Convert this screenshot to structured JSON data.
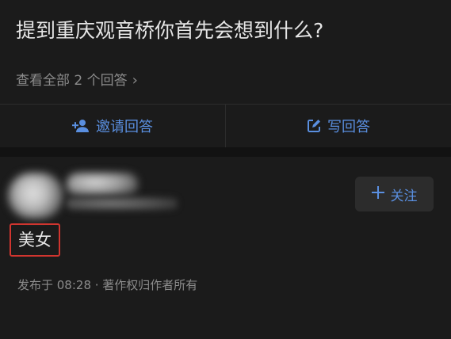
{
  "question": {
    "title": "提到重庆观音桥你首先会想到什么?",
    "view_all": "查看全部 2 个回答"
  },
  "actions": {
    "invite_label": "邀请回答",
    "write_label": "写回答"
  },
  "answer": {
    "follow_label": "关注",
    "text": "美女",
    "meta": "发布于 08:28 · 著作权归作者所有"
  },
  "colors": {
    "background": "#121212",
    "card": "#1b1b1b",
    "accent": "#5a8fe0",
    "highlight_border": "#d0352f"
  },
  "icons": {
    "invite": "add-person-icon",
    "write": "edit-icon",
    "follow": "plus-icon",
    "view_all": "chevron-right-icon"
  }
}
